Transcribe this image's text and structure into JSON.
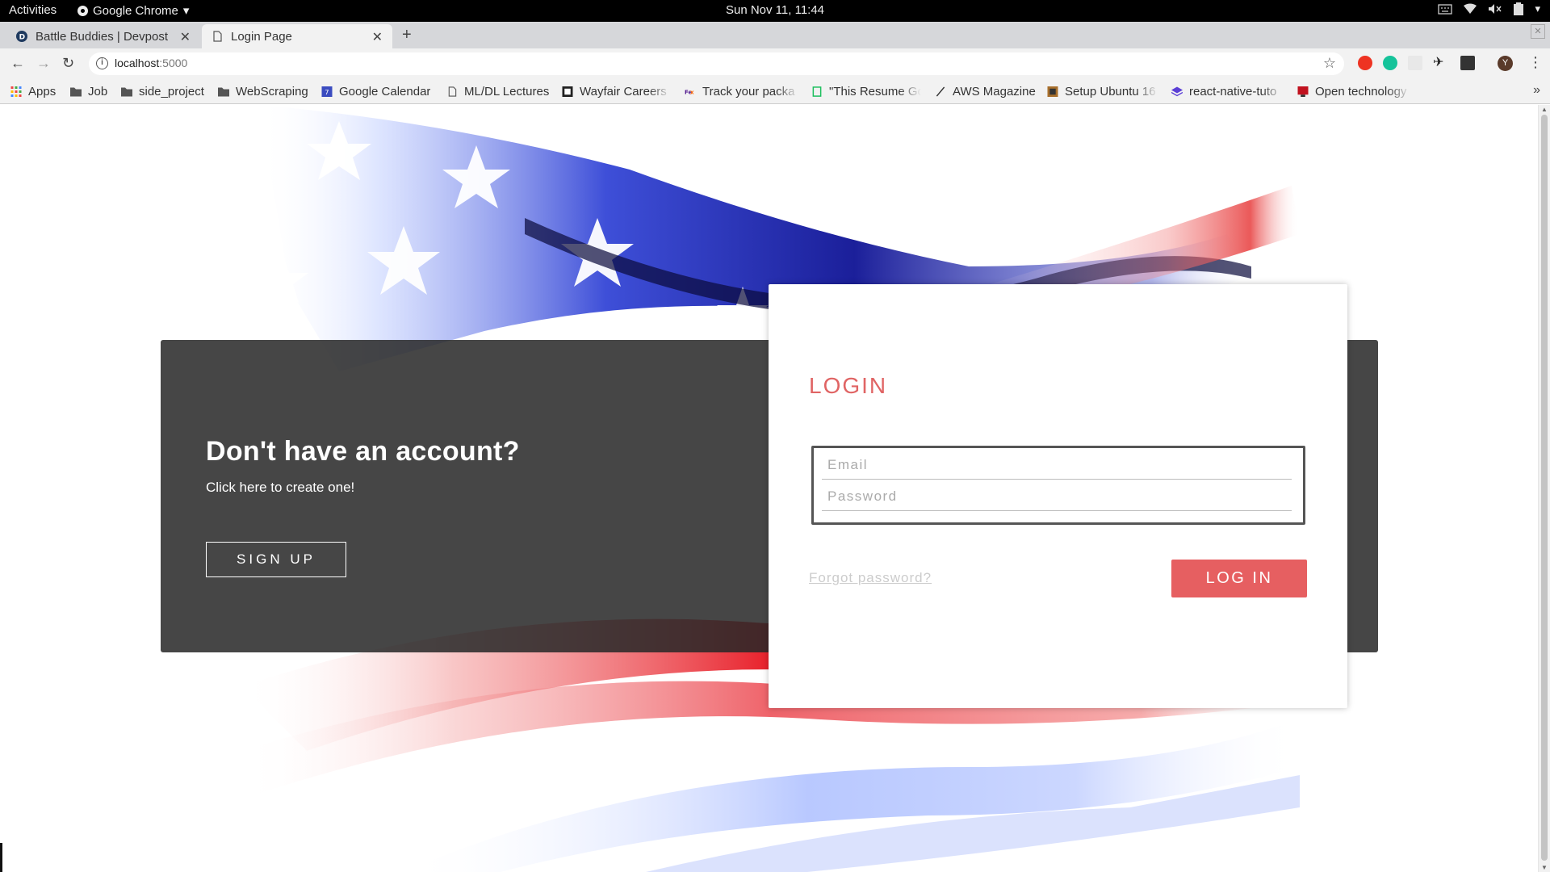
{
  "topbar": {
    "activities": "Activities",
    "app_name": "Google Chrome",
    "clock": "Sun Nov 11, 11:44"
  },
  "tabs": [
    {
      "title": "Battle Buddies | Devpost",
      "active": false
    },
    {
      "title": "Login Page",
      "active": true
    }
  ],
  "omnibox": {
    "host": "localhost",
    "port": ":5000"
  },
  "profile_initial": "Y",
  "bookmarks": [
    {
      "label": "Apps",
      "icon": "apps-grid-icon"
    },
    {
      "label": "Job",
      "icon": "folder-icon"
    },
    {
      "label": "side_project",
      "icon": "folder-icon"
    },
    {
      "label": "WebScraping",
      "icon": "folder-icon"
    },
    {
      "label": "Google Calendar",
      "icon": "calendar-icon"
    },
    {
      "label": "ML/DL Lectures",
      "icon": "page-icon"
    },
    {
      "label": "Wayfair Careers",
      "icon": "wayfair-icon"
    },
    {
      "label": "Track your packa",
      "icon": "fedex-icon"
    },
    {
      "label": "\"This Resume Go",
      "icon": "doc-icon"
    },
    {
      "label": "AWS Magazine",
      "icon": "pen-icon"
    },
    {
      "label": "Setup Ubuntu 16",
      "icon": "image-icon"
    },
    {
      "label": "react-native-tuto",
      "icon": "layers-icon"
    },
    {
      "label": "Open technology",
      "icon": "monitor-icon"
    }
  ],
  "signup": {
    "heading": "Don't have an account?",
    "subtext": "Click here to create one!",
    "button": "SIGN UP"
  },
  "login": {
    "title": "LOGIN",
    "email_placeholder": "Email",
    "password_placeholder": "Password",
    "forgot": "Forgot password?",
    "button": "LOG IN"
  },
  "colors": {
    "accent": "#e65f61",
    "title": "#e06464",
    "panel": "#3b3b3b"
  }
}
